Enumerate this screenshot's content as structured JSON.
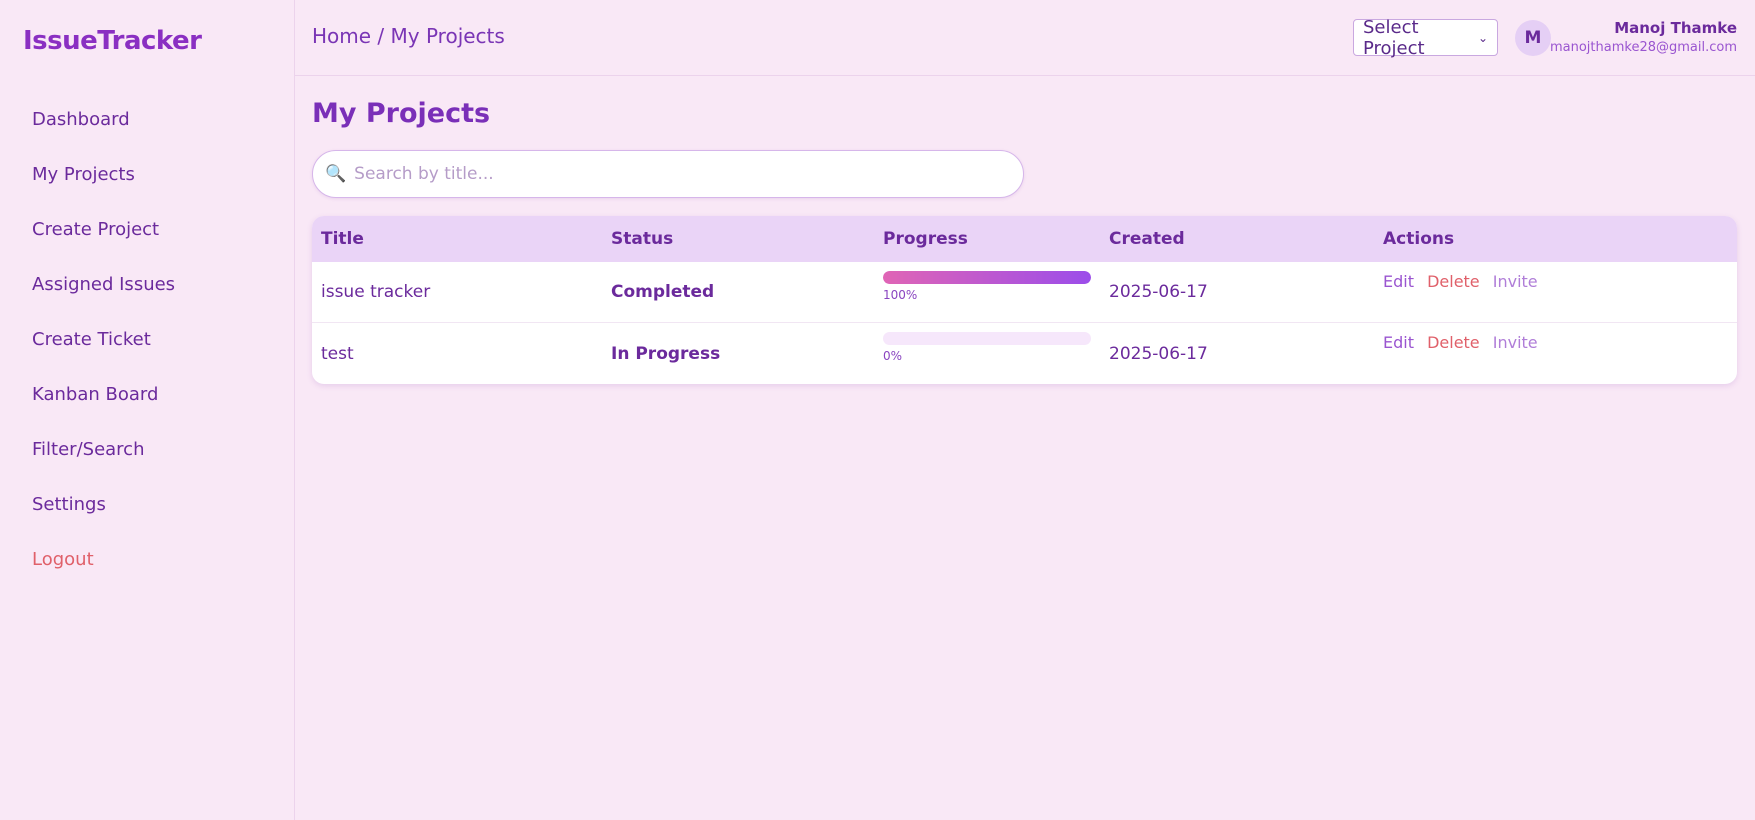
{
  "app": {
    "brand": "IssueTracker"
  },
  "sidebar": {
    "items": [
      {
        "label": "Dashboard"
      },
      {
        "label": "My Projects"
      },
      {
        "label": "Create Project"
      },
      {
        "label": "Assigned Issues"
      },
      {
        "label": "Create Ticket"
      },
      {
        "label": "Kanban Board"
      },
      {
        "label": "Filter/Search"
      },
      {
        "label": "Settings"
      },
      {
        "label": "Logout"
      }
    ]
  },
  "header": {
    "breadcrumb": "Home / My Projects",
    "project_select": "Select Project",
    "user": {
      "initial": "M",
      "name": "Manoj Thamke",
      "email": "manojthamke28@gmail.com"
    }
  },
  "main": {
    "title": "My Projects",
    "search": {
      "placeholder": "Search by title...",
      "value": ""
    },
    "table": {
      "columns": [
        "Title",
        "Status",
        "Progress",
        "Created",
        "Actions"
      ],
      "rows": [
        {
          "title": "issue tracker",
          "status": "Completed",
          "progress": 1.0,
          "progress_label": "100%",
          "created": "2025-06-17",
          "actions": {
            "edit": "Edit",
            "delete": "Delete",
            "invite": "Invite"
          }
        },
        {
          "title": "test",
          "status": "In Progress",
          "progress": 0.0,
          "progress_label": "0%",
          "created": "2025-06-17",
          "actions": {
            "edit": "Edit",
            "delete": "Delete",
            "invite": "Invite"
          }
        }
      ]
    }
  },
  "colors": {
    "accent": "#7a2fb8",
    "danger": "#e0606a",
    "background": "#f9e8f6",
    "header_row": "#ead4f7"
  },
  "icons": {
    "search": "magnifier-icon",
    "select": "chevron-down-icon"
  }
}
